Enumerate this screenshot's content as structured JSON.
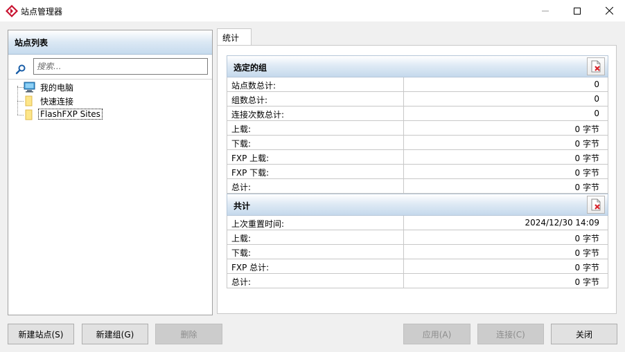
{
  "window": {
    "title": "站点管理器",
    "icons": {
      "app": "flashfxp-logo-icon",
      "minimize": "minimize-icon",
      "maximize": "maximize-icon",
      "close": "close-icon"
    }
  },
  "site_list": {
    "header": "站点列表",
    "search": {
      "placeholder": "搜索...",
      "value": ""
    },
    "tree": [
      {
        "label": "我的电脑",
        "icon": "computer-icon"
      },
      {
        "label": "快速连接",
        "icon": "folder-icon"
      },
      {
        "label": "FlashFXP Sites",
        "icon": "folder-icon",
        "selected": true
      }
    ]
  },
  "tabs": [
    {
      "label": "统计",
      "active": true
    }
  ],
  "selected_group": {
    "title": "选定的组",
    "rows": [
      {
        "label": "站点数总计:",
        "value": "0"
      },
      {
        "label": "组数总计:",
        "value": "0"
      },
      {
        "label": "连接次数总计:",
        "value": "0"
      },
      {
        "label": "上载:",
        "value": "0 字节"
      },
      {
        "label": "下载:",
        "value": "0 字节"
      },
      {
        "label": "FXP 上载:",
        "value": "0 字节"
      },
      {
        "label": "FXP 下载:",
        "value": "0 字节"
      },
      {
        "label": "总计:",
        "value": "0 字节"
      }
    ]
  },
  "total": {
    "title": "共计",
    "rows": [
      {
        "label": "上次重置时间:",
        "value": "2024/12/30 14:09"
      },
      {
        "label": "上载:",
        "value": "0 字节"
      },
      {
        "label": "下载:",
        "value": "0 字节"
      },
      {
        "label": "FXP 总计:",
        "value": "0 字节"
      },
      {
        "label": "总计:",
        "value": "0 字节"
      }
    ]
  },
  "buttons": {
    "new_site": "新建站点(S)",
    "new_group": "新建组(G)",
    "delete": "删除",
    "apply": "应用(A)",
    "connect": "连接(C)",
    "close": "关闭"
  },
  "colors": {
    "header_gradient": "#c6dbee",
    "accent_red": "#c8102e"
  }
}
